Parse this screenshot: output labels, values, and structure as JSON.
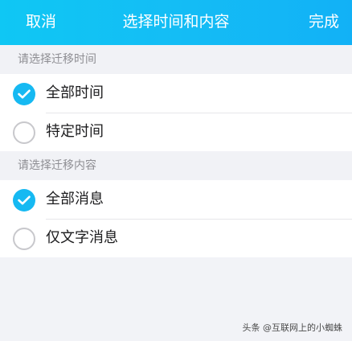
{
  "navbar": {
    "cancel_label": "取消",
    "title": "选择时间和内容",
    "done_label": "完成",
    "color": "#14bdf5"
  },
  "sections": [
    {
      "header": "请选择迁移时间",
      "options": [
        {
          "label": "全部时间",
          "checked": true
        },
        {
          "label": "特定时间",
          "checked": false
        }
      ]
    },
    {
      "header": "请选择迁移内容",
      "options": [
        {
          "label": "全部消息",
          "checked": true
        },
        {
          "label": "仅文字消息",
          "checked": false
        }
      ]
    }
  ],
  "watermark": "头条 @互联网上的小蜘蛛",
  "accent_color": "#16b9f2",
  "icons": {
    "checked": "checkmark-icon"
  }
}
